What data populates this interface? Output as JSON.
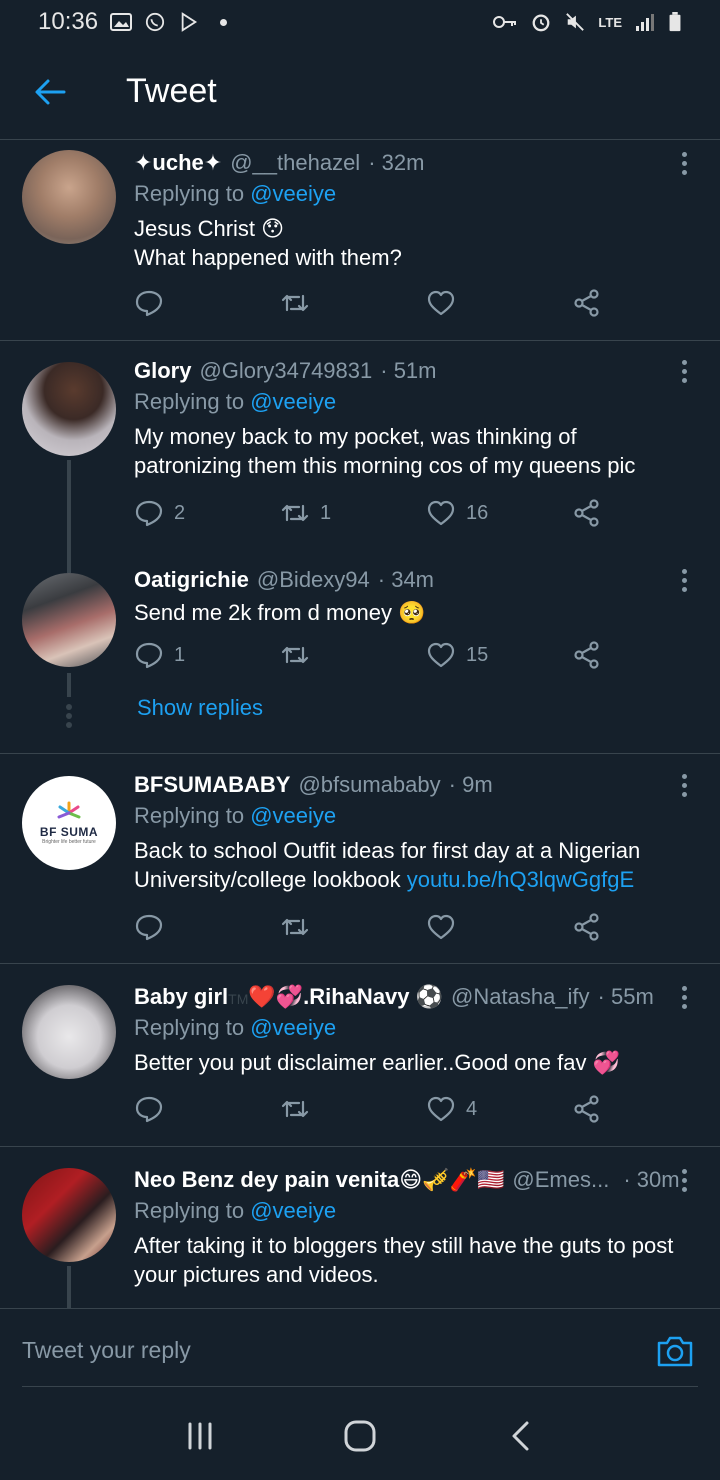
{
  "status_bar": {
    "time": "10:36",
    "network": "LTE"
  },
  "header": {
    "title": "Tweet"
  },
  "colors": {
    "accent": "#1da1f2",
    "background": "#15202b",
    "muted": "#8899a6",
    "divider": "#38444d"
  },
  "tweets": [
    {
      "name": "✦uche✦",
      "handle": "@__thehazel",
      "time": "· 32m",
      "replying_label": "Replying to",
      "replying_to": "@veeiye",
      "text_lines": [
        "Jesus Christ 😯",
        "What happened with them?"
      ],
      "replies": "",
      "retweets": "",
      "likes": ""
    },
    {
      "name": "Glory",
      "handle": "@Glory34749831",
      "time": "· 51m",
      "replying_label": "Replying to",
      "replying_to": "@veeiye",
      "text": "My money back to my pocket, was thinking of patronizing them this morning cos of my queens pic",
      "replies": "2",
      "retweets": "1",
      "likes": "16"
    },
    {
      "name": "Oatigrichie",
      "handle": "@Bidexy94",
      "time": "· 34m",
      "text": "Send me 2k from d money 🥺",
      "replies": "1",
      "retweets": "",
      "likes": "15",
      "show_replies": "Show replies"
    },
    {
      "name": "BFSUMABABY",
      "handle": "@bfsumababy",
      "time": "· 9m",
      "replying_label": "Replying to",
      "replying_to": "@veeiye",
      "text": "Back to school Outfit ideas for first day at a Nigerian University/college lookbook",
      "link": "youtu.be/hQ3lqwGgfgE",
      "avatar_text": "BF SUMA",
      "avatar_tagline": "Brighter life better future",
      "replies": "",
      "retweets": "",
      "likes": ""
    },
    {
      "name": "Baby girl",
      "name_tm": "TM",
      "name_suffix": "❤️💞.RihaNavy ⚽",
      "handle": "@Natasha_ify",
      "time": "· 55m",
      "replying_label": "Replying to",
      "replying_to": "@veeiye",
      "text": "Better you put disclaimer earlier..Good one fav 💞",
      "replies": "",
      "retweets": "",
      "likes": "4"
    },
    {
      "name": "Neo Benz dey pain venita😄🎺🧨🇺🇸",
      "handle": "@Emes...",
      "time": "· 30m",
      "replying_label": "Replying to",
      "replying_to": "@veeiye",
      "text": "After taking it to bloggers they still have the guts to post your pictures and videos."
    }
  ],
  "reply_box": {
    "placeholder": "Tweet your reply"
  },
  "icons": [
    "back-arrow-icon",
    "reply-icon",
    "retweet-icon",
    "like-icon",
    "share-icon",
    "more-icon",
    "camera-icon",
    "recents-icon",
    "home-icon",
    "back-icon"
  ]
}
